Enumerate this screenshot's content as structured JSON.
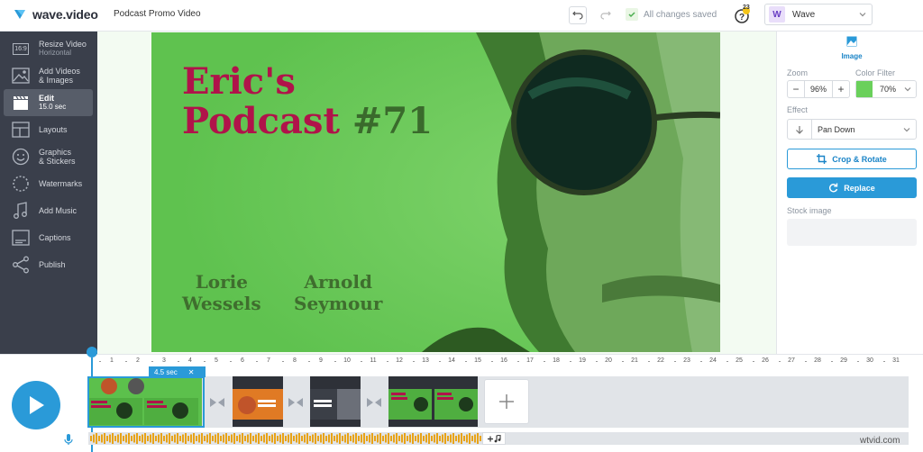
{
  "app": {
    "name": "wave.video",
    "project": "Podcast Promo Video"
  },
  "header": {
    "saved_status": "All changes saved",
    "help_count": "23",
    "workspace_initial": "W",
    "workspace_name": "Wave"
  },
  "sidebar": {
    "items": [
      {
        "label": "Resize Video",
        "sub": "Horizontal",
        "icon": "resize-icon",
        "badge": "16:9"
      },
      {
        "label": "Add Videos",
        "label2": "& Images",
        "icon": "image-icon"
      },
      {
        "label": "Edit",
        "sub": "15.0 sec",
        "icon": "clapperboard-icon",
        "active": true
      },
      {
        "label": "Layouts",
        "icon": "layouts-icon"
      },
      {
        "label": "Graphics",
        "label2": "& Stickers",
        "icon": "sticker-icon"
      },
      {
        "label": "Watermarks",
        "icon": "watermark-icon"
      },
      {
        "label": "Add Music",
        "icon": "music-icon"
      },
      {
        "label": "Captions",
        "icon": "captions-icon"
      },
      {
        "label": "Publish",
        "icon": "share-icon"
      }
    ]
  },
  "canvas": {
    "title_line1": "Eric's",
    "title_line2": "Podcast",
    "title_num": "#71",
    "name1_first": "Lorie",
    "name1_last": "Wessels",
    "name2_first": "Arnold",
    "name2_last": "Seymour"
  },
  "panel": {
    "tab_image": "Image",
    "zoom_label": "Zoom",
    "zoom_value": "96%",
    "color_filter_label": "Color Filter",
    "color_filter_value": "70%",
    "color_filter_swatch": "#6ad05b",
    "effect_label": "Effect",
    "effect_value": "Pan Down",
    "crop_label": "Crop & Rotate",
    "replace_label": "Replace",
    "stock_label": "Stock image"
  },
  "timeline": {
    "ruler": [
      "1",
      "2",
      "3",
      "4",
      "5",
      "6",
      "7",
      "8",
      "9",
      "10",
      "11",
      "12",
      "13",
      "14",
      "15",
      "16",
      "17",
      "18",
      "19",
      "20",
      "21",
      "22",
      "23",
      "24",
      "25",
      "26",
      "27",
      "28",
      "29",
      "30",
      "31"
    ],
    "selected_duration": "4.5 sec",
    "clips": [
      {
        "caption": "Eric's Podcast #71"
      },
      {
        "caption": "Lorie Wessels"
      },
      {
        "caption": "Arnold Seymour"
      },
      {
        "caption": "Eric's Podcast"
      }
    ]
  },
  "watermark": "wtvid.com",
  "colors": {
    "accent": "#2a9ad8",
    "sidebar": "#3a3f4b",
    "brand_green": "#6ccf5c",
    "title_pink": "#b0134a"
  }
}
